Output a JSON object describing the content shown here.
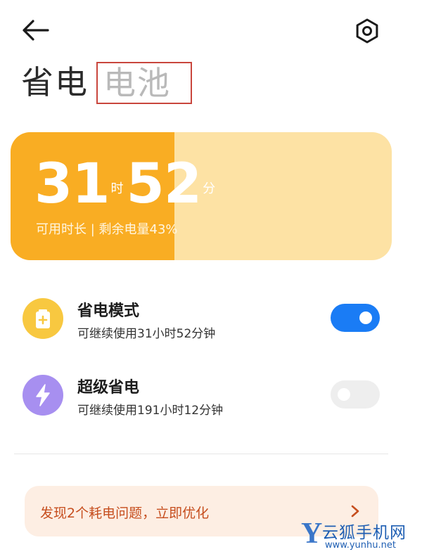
{
  "header": {
    "back_icon": "arrow-left-icon",
    "settings_icon": "gear-icon"
  },
  "tabs": [
    {
      "label": "省电",
      "active": true
    },
    {
      "label": "电池",
      "active": false
    }
  ],
  "battery": {
    "hours": "31",
    "hours_unit": "时",
    "minutes": "52",
    "minutes_unit": "分",
    "subtitle": "可用时长 | 剩余电量43%",
    "level_fraction": 0.43,
    "fill_color": "#f9ad23",
    "bg_color": "#fde2a4"
  },
  "modes": [
    {
      "title": "省电模式",
      "subtitle": "可继续使用31小时52分钟",
      "icon": "battery-plus-icon",
      "icon_color": "#f8c840",
      "enabled": true
    },
    {
      "title": "超级省电",
      "subtitle": "可继续使用191小时12分钟",
      "icon": "lightning-bolt-icon",
      "icon_color": "#a78ff0",
      "enabled": false
    }
  ],
  "optimize": {
    "label": "发现2个耗电问题，立即优化",
    "arrow_icon": "chevron-right-icon"
  },
  "watermark": {
    "logo_letter": "Y",
    "name": "云狐手机网",
    "url": "www.yunhu.net"
  },
  "colors": {
    "toggle_on": "#1a7cf5",
    "toggle_off": "#eeeeee",
    "optimize_text": "#c64e1e"
  }
}
